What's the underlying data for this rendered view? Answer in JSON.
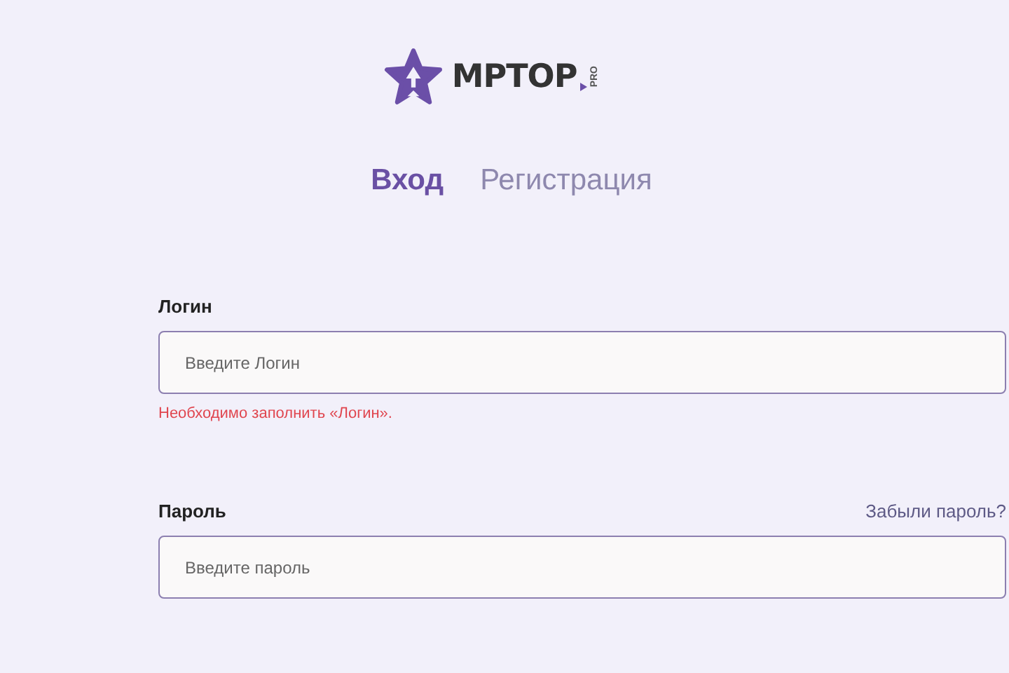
{
  "logo": {
    "text": "MPTOP",
    "suffix": "PRO"
  },
  "tabs": [
    {
      "label": "Вход",
      "selected": true
    },
    {
      "label": "Регистрация",
      "selected": false
    }
  ],
  "fields": [
    {
      "label": "Логин",
      "placeholder": "Введите Логин",
      "error": "Необходимо заполнить «Логин»."
    },
    {
      "label": "Пароль",
      "placeholder": "Введите пароль",
      "link": "Забыли пароль?"
    }
  ]
}
